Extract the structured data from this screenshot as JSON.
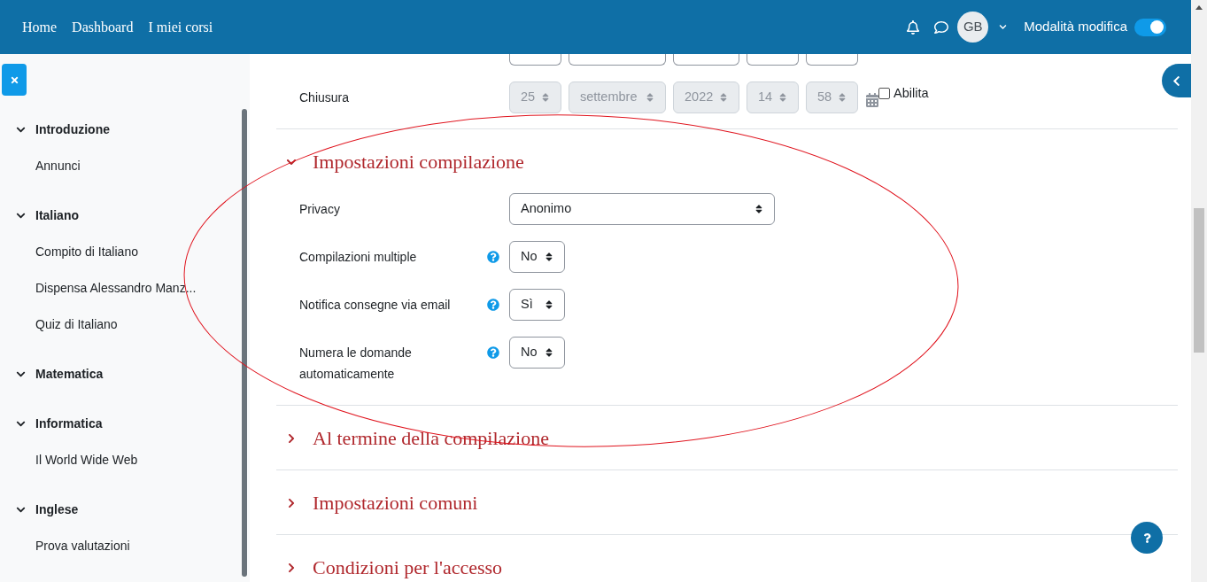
{
  "navbar": {
    "links": [
      "Home",
      "Dashboard",
      "I miei corsi"
    ],
    "avatar": "GB",
    "edit_mode": {
      "label": "Modalità modifica",
      "on": true
    }
  },
  "sidebar": {
    "sections": [
      {
        "title": "Introduzione",
        "expanded": true,
        "items": [
          "Annunci"
        ]
      },
      {
        "title": "Italiano",
        "expanded": true,
        "items": [
          "Compito di Italiano",
          "Dispensa Alessandro Manz...",
          "Quiz di Italiano"
        ]
      },
      {
        "title": "Matematica",
        "expanded": true
      },
      {
        "title": "Informatica",
        "expanded": true,
        "items": [
          "Il World Wide Web"
        ]
      },
      {
        "title": "Inglese",
        "expanded": true,
        "items": [
          "Prova valutazioni"
        ]
      }
    ]
  },
  "date_row": {
    "label": "Chiusura",
    "disabled": true,
    "fields": [
      "25",
      "settembre",
      "2022",
      "14",
      "58"
    ],
    "enable": {
      "label": "Abilita",
      "checked": false
    }
  },
  "sections": [
    {
      "title": "Impostazioni compilazione",
      "expanded": true,
      "rows": [
        {
          "label": "Privacy",
          "help": false,
          "value": "Anonimo",
          "kind": "wide"
        },
        {
          "label": "Compilazioni multiple",
          "help": true,
          "value": "No",
          "kind": "narrow"
        },
        {
          "label": "Notifica consegne via email",
          "help": true,
          "value": "Sì",
          "kind": "narrow"
        },
        {
          "label": "Numera le domande automaticamente",
          "help": true,
          "value": "No",
          "kind": "narrow"
        }
      ]
    },
    {
      "title": "Al termine della compilazione",
      "expanded": false
    },
    {
      "title": "Impostazioni comuni",
      "expanded": false
    },
    {
      "title": "Condizioni per l'accesso",
      "expanded": false
    }
  ]
}
